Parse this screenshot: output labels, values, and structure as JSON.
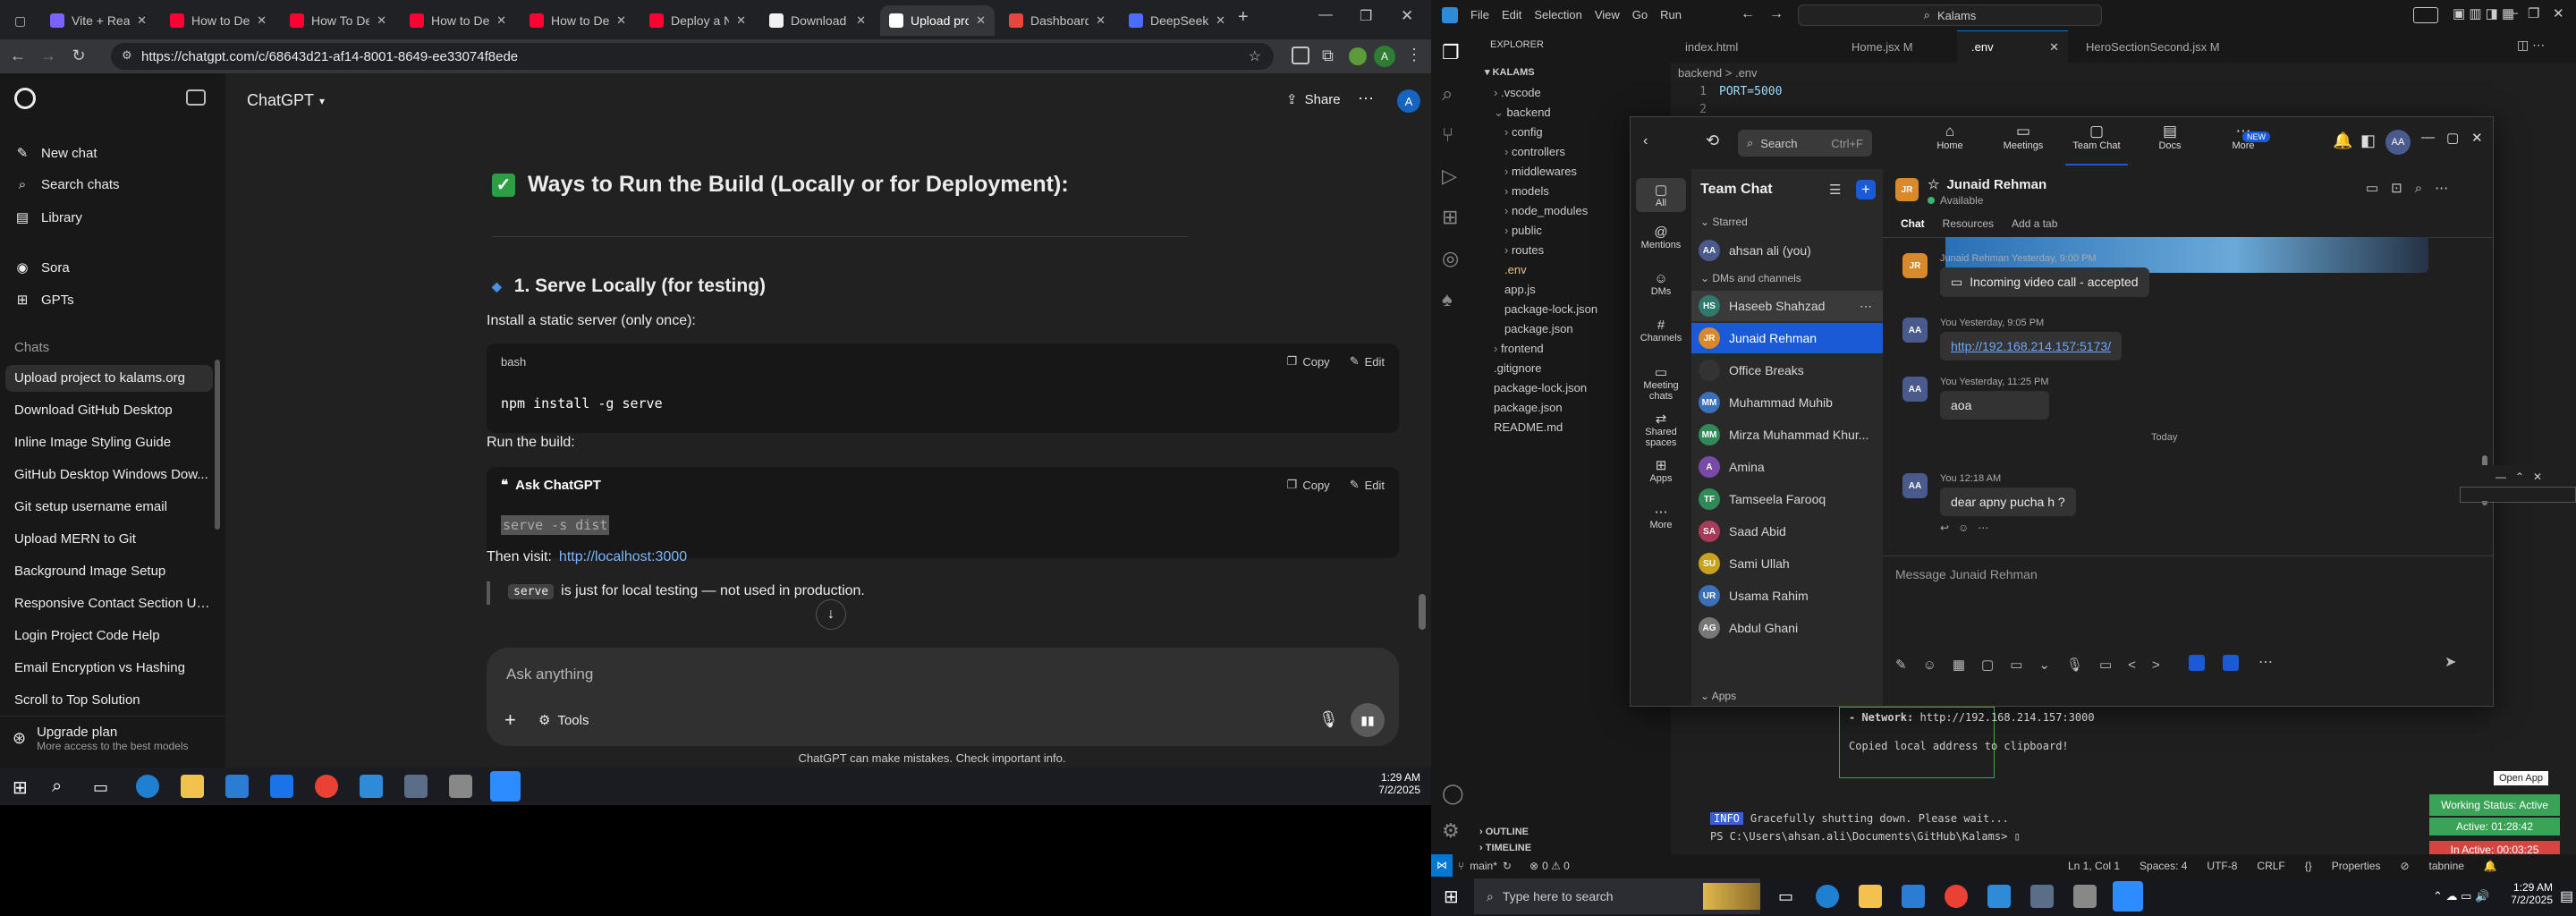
{
  "chrome": {
    "tabs": [
      {
        "label": "Vite + React",
        "color": "#7b61ff"
      },
      {
        "label": "How to De",
        "color": "#ff0033"
      },
      {
        "label": "How To De",
        "color": "#ff0033"
      },
      {
        "label": "How to De",
        "color": "#ff0033"
      },
      {
        "label": "How to De",
        "color": "#ff0033"
      },
      {
        "label": "Deploy a N",
        "color": "#ff0033"
      },
      {
        "label": "Download G",
        "color": "#f1f1f1"
      },
      {
        "label": "Upload pro",
        "color": "#ffffff"
      },
      {
        "label": "Dashboard",
        "color": "#e8453c"
      },
      {
        "label": "DeepSeek",
        "color": "#4d6bfe"
      }
    ],
    "url": "https://chatgpt.com/c/68643d21-af14-8001-8649-ee33074f8ede",
    "profile_letter": "A"
  },
  "chatgpt": {
    "brand": "ChatGPT",
    "share_label": "Share",
    "avatar_letter": "A",
    "nav": [
      {
        "label": "New chat",
        "icon": "edit-icon"
      },
      {
        "label": "Search chats",
        "icon": "search-icon"
      },
      {
        "label": "Library",
        "icon": "library-icon"
      },
      {
        "label": "Sora",
        "icon": "sora-icon"
      },
      {
        "label": "GPTs",
        "icon": "gpts-icon"
      }
    ],
    "chats_heading": "Chats",
    "chats": [
      "Upload project to kalams.org",
      "Download GitHub Desktop",
      "Inline Image Styling Guide",
      "GitHub Desktop Windows Dow...",
      "Git setup username email",
      "Upload MERN to Git",
      "Background Image Setup",
      "Responsive Contact Section Up...",
      "Login Project Code Help",
      "Email Encryption vs Hashing",
      "Scroll to Top Solution"
    ],
    "upgrade": {
      "title": "Upgrade plan",
      "subtitle": "More access to the best models"
    },
    "content": {
      "heading": "Ways to Run the Build (Locally or for Deployment):",
      "section": "1. Serve Locally (for testing)",
      "install_text": "Install a static server (only once):",
      "code1_lang": "bash",
      "code1": "npm install -g serve",
      "copy_label": "Copy",
      "edit_label": "Edit",
      "run_text": "Run the build:",
      "code2_lang": "Ask ChatGPT",
      "code2": "serve -s dist",
      "visit_prefix": "Then visit:",
      "visit_link": "http://localhost:3000",
      "note_code": "serve",
      "note_text": "is just for local testing — not used in production."
    },
    "composer": {
      "placeholder": "Ask anything",
      "tools_label": "Tools"
    },
    "disclaimer": "ChatGPT can make mistakes. Check important info."
  },
  "taskbar_left": {
    "time": "1:29 AM",
    "date": "7/2/2025"
  },
  "vscode": {
    "menu": [
      "File",
      "Edit",
      "Selection",
      "View",
      "Go",
      "Run"
    ],
    "search": "Kalams",
    "tabs": [
      {
        "label": "index.html",
        "active": false
      },
      {
        "label": "Home.jsx M",
        "active": false
      },
      {
        "label": ".env",
        "active": true
      },
      {
        "label": "HeroSectionSecond.jsx M",
        "active": false
      }
    ],
    "breadcrumb": "backend  >  .env",
    "editor_lines": [
      {
        "num": "1",
        "text": "PORT=5000"
      },
      {
        "num": "2",
        "text": ""
      }
    ],
    "explorer_title": "EXPLORER",
    "workspace": "KALAMS",
    "tree": [
      {
        "label": ".vscode",
        "type": "folder",
        "depth": 1
      },
      {
        "label": "backend",
        "type": "folder-open",
        "depth": 1
      },
      {
        "label": "config",
        "type": "folder",
        "depth": 2
      },
      {
        "label": "controllers",
        "type": "folder",
        "depth": 2
      },
      {
        "label": "middlewares",
        "type": "folder",
        "depth": 2
      },
      {
        "label": "models",
        "type": "folder",
        "depth": 2
      },
      {
        "label": "node_modules",
        "type": "folder",
        "depth": 2
      },
      {
        "label": "public",
        "type": "folder",
        "depth": 2
      },
      {
        "label": "routes",
        "type": "folder",
        "depth": 2
      },
      {
        "label": ".env",
        "type": "file",
        "depth": 2
      },
      {
        "label": "app.js",
        "type": "file",
        "depth": 2
      },
      {
        "label": "package-lock.json",
        "type": "file",
        "depth": 2
      },
      {
        "label": "package.json",
        "type": "file",
        "depth": 2
      },
      {
        "label": "frontend",
        "type": "folder",
        "depth": 1
      },
      {
        "label": ".gitignore",
        "type": "file",
        "depth": 1
      },
      {
        "label": "package-lock.json",
        "type": "file",
        "depth": 1
      },
      {
        "label": "package.json",
        "type": "file",
        "depth": 1
      },
      {
        "label": "README.md",
        "type": "file",
        "depth": 1
      }
    ],
    "outline": "OUTLINE",
    "timeline": "TIMELINE",
    "terminal": {
      "network_label": "- Network:",
      "network_url": "http://192.168.214.157:3000",
      "copied": "Copied local address to clipboard!",
      "info_tag": "INFO",
      "info_text": "Gracefully shutting down. Please wait...",
      "prompt": "PS C:\\Users\\ahsan.ali\\Documents\\GitHub\\Kalams>"
    },
    "status": {
      "branch": "main*",
      "problems": "0 ⚠ 0",
      "errors": "⊗",
      "warnings": "0",
      "position": "Ln 1, Col 1",
      "spaces": "Spaces: 4",
      "encoding": "UTF-8",
      "eol": "CRLF",
      "properties": "Properties",
      "tabnine": "tabnine"
    }
  },
  "overlay_widgets": {
    "open_app": "Open App",
    "working_status": "Working Status: Active",
    "active": "Active: 01:28:42",
    "inactive": "In Active: 00:03:25"
  },
  "teams": {
    "search_label": "Search",
    "search_shortcut": "Ctrl+F",
    "top_nav": [
      {
        "label": "Home",
        "icon": "home-icon"
      },
      {
        "label": "Meetings",
        "icon": "meetings-icon"
      },
      {
        "label": "Team Chat",
        "icon": "chat-icon"
      },
      {
        "label": "Docs",
        "icon": "docs-icon"
      },
      {
        "label": "More",
        "icon": "more-icon"
      }
    ],
    "new_badge": "NEW",
    "user_initials": "AA",
    "rail": [
      {
        "label": "All",
        "icon": "chat-icon"
      },
      {
        "label": "Mentions",
        "icon": "at-icon"
      },
      {
        "label": "DMs",
        "icon": "dm-icon"
      },
      {
        "label": "Channels",
        "icon": "channels-icon"
      },
      {
        "label": "Meeting chats",
        "icon": "meeting-chat-icon"
      },
      {
        "label": "Shared spaces",
        "icon": "shared-icon"
      },
      {
        "label": "Apps",
        "icon": "apps-icon"
      },
      {
        "label": "More",
        "icon": "more-icon"
      }
    ],
    "list_title": "Team Chat",
    "starred": "Starred",
    "dms_heading": "DMs and channels",
    "me": {
      "name": "ahsan ali (you)",
      "initials": "AA",
      "color": "#4a5a8c"
    },
    "contacts": [
      {
        "name": "Haseeb Shahzad",
        "initials": "HS",
        "color": "#2f7a6b",
        "selected": false,
        "hover": true
      },
      {
        "name": "Junaid Rehman",
        "initials": "JR",
        "color": "#d9892a",
        "selected": true,
        "hover": false
      },
      {
        "name": "Office Breaks",
        "initials": "",
        "color": "#333333",
        "selected": false,
        "hover": false
      },
      {
        "name": "Muhammad Muhib",
        "initials": "MM",
        "color": "#3b6fb6",
        "selected": false,
        "hover": false
      },
      {
        "name": "Mirza Muhammad Khur...",
        "initials": "MM",
        "color": "#2f8a57",
        "selected": false,
        "hover": false
      },
      {
        "name": "Amina",
        "initials": "A",
        "color": "#7a4aa8",
        "selected": false,
        "hover": false
      },
      {
        "name": "Tamseela Farooq",
        "initials": "TF",
        "color": "#2f8a57",
        "selected": false,
        "hover": false
      },
      {
        "name": "Saad Abid",
        "initials": "SA",
        "color": "#a83a5a",
        "selected": false,
        "hover": false
      },
      {
        "name": "Sami Ullah",
        "initials": "SU",
        "color": "#c7a21f",
        "selected": false,
        "hover": false
      },
      {
        "name": "Usama Rahim",
        "initials": "UR",
        "color": "#3b6fb6",
        "selected": false,
        "hover": false
      },
      {
        "name": "Abdul Ghani",
        "initials": "AG",
        "color": "#777777",
        "selected": false,
        "hover": false
      }
    ],
    "apps_heading": "Apps",
    "chat": {
      "name": "Junaid Rehman",
      "initials": "JR",
      "status": "Available",
      "tabs": [
        "Chat",
        "Resources",
        "Add a tab"
      ],
      "messages": [
        {
          "author": "Junaid Rehman",
          "time": "Yesterday, 9:00 PM",
          "text": "Incoming video call - accepted",
          "initials": "JR",
          "color": "#d9892a",
          "link": false
        },
        {
          "author": "You",
          "time": "Yesterday, 9:05 PM",
          "text": "http://192.168.214.157:5173/",
          "initials": "AA",
          "color": "#4a5a8c",
          "link": true
        },
        {
          "author": "You",
          "time": "Yesterday, 11:25 PM",
          "text": "aoa",
          "initials": "AA",
          "color": "#4a5a8c",
          "link": false
        },
        {
          "author": "You",
          "time": "12:18 AM",
          "text": "dear apny pucha h ?",
          "initials": "AA",
          "color": "#4a5a8c",
          "link": false
        }
      ],
      "divider": "Today",
      "compose_placeholder": "Message Junaid Rehman"
    }
  },
  "taskbar_right": {
    "search_placeholder": "Type here to search",
    "time": "1:29 AM",
    "date": "7/2/2025"
  }
}
